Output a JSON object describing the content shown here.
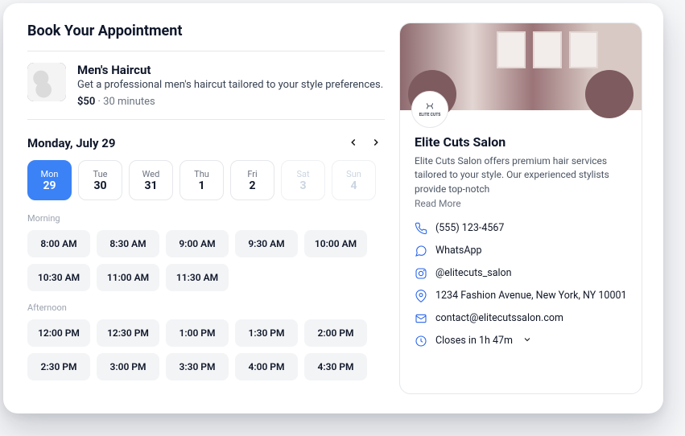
{
  "page_title": "Book Your Appointment",
  "service": {
    "title": "Men's Haircut",
    "description": "Get a professional men's haircut tailored to your style preferences.",
    "price": "$50",
    "duration_sep": " · ",
    "duration": "30 minutes"
  },
  "date": {
    "selected_label": "Monday, July 29",
    "days": [
      {
        "dow": "Mon",
        "num": "29",
        "state": "selected"
      },
      {
        "dow": "Tue",
        "num": "30",
        "state": "enabled"
      },
      {
        "dow": "Wed",
        "num": "31",
        "state": "enabled"
      },
      {
        "dow": "Thu",
        "num": "1",
        "state": "enabled"
      },
      {
        "dow": "Fri",
        "num": "2",
        "state": "enabled"
      },
      {
        "dow": "Sat",
        "num": "3",
        "state": "disabled"
      },
      {
        "dow": "Sun",
        "num": "4",
        "state": "disabled"
      }
    ]
  },
  "sections": {
    "morning_label": "Morning",
    "afternoon_label": "Afternoon"
  },
  "slots": {
    "morning": [
      "8:00 AM",
      "8:30 AM",
      "9:00 AM",
      "9:30 AM",
      "10:00 AM",
      "10:30 AM",
      "11:00 AM",
      "11:30 AM"
    ],
    "afternoon": [
      "12:00 PM",
      "12:30 PM",
      "1:00 PM",
      "1:30 PM",
      "2:00 PM",
      "2:30 PM",
      "3:00 PM",
      "3:30 PM",
      "4:00 PM",
      "4:30 PM"
    ]
  },
  "salon": {
    "logo_text": "ELITE CUTS",
    "name": "Elite Cuts Salon",
    "description": "Elite Cuts Salon offers premium hair services tailored to your style. Our experienced stylists provide top-notch",
    "read_more": "Read More",
    "phone": "(555) 123-4567",
    "whatsapp": "WhatsApp",
    "instagram": "@elitecuts_salon",
    "address": "1234 Fashion Avenue, New York, NY 10001",
    "email": "contact@elitecutssalon.com",
    "hours": "Closes in 1h 47m"
  }
}
